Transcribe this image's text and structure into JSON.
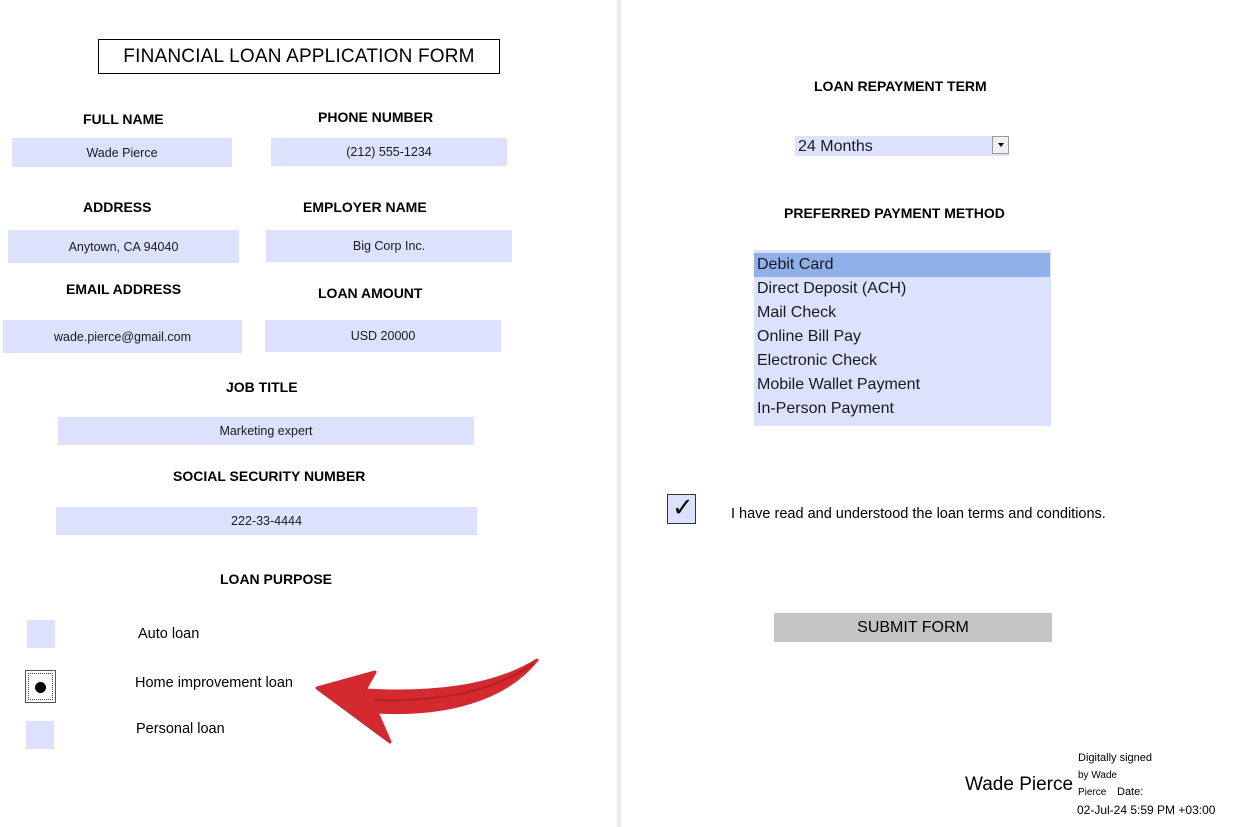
{
  "form": {
    "title": "FINANCIAL LOAN APPLICATION FORM"
  },
  "fields": {
    "full_name": {
      "label": "FULL NAME",
      "value": "Wade Pierce"
    },
    "phone_number": {
      "label": "PHONE NUMBER",
      "value": "(212) 555-1234"
    },
    "address": {
      "label": "ADDRESS",
      "value": "Anytown, CA 94040"
    },
    "employer_name": {
      "label": "EMPLOYER NAME",
      "value": "Big Corp Inc."
    },
    "email_address": {
      "label": "EMAIL ADDRESS",
      "value": "wade.pierce@gmail.com"
    },
    "loan_amount": {
      "label": "LOAN AMOUNT",
      "value": "USD 20000"
    },
    "job_title": {
      "label": "JOB TITLE",
      "value": "Marketing expert"
    },
    "ssn": {
      "label": "SOCIAL SECURITY NUMBER",
      "value": "222-33-4444"
    }
  },
  "loan_purpose": {
    "label": "LOAN PURPOSE",
    "options": [
      "Auto loan",
      "Home improvement loan",
      "Personal loan"
    ],
    "selected": "Home improvement loan"
  },
  "repayment_term": {
    "label": "LOAN REPAYMENT TERM",
    "value": "24 Months"
  },
  "payment_method": {
    "label": "PREFERRED PAYMENT METHOD",
    "options": [
      "Debit Card",
      "Direct Deposit (ACH)",
      "Mail Check",
      "Online Bill Pay",
      "Electronic Check",
      "Mobile Wallet Payment",
      "In-Person Payment"
    ],
    "selected": "Debit Card"
  },
  "terms": {
    "checked": true,
    "label": "I have read and understood the loan terms and conditions."
  },
  "submit": {
    "label": "SUBMIT FORM"
  },
  "signature": {
    "name": "Wade Pierce",
    "line1": "Digitally signed",
    "line2": "by Wade",
    "line3a": "Pierce",
    "line3b": "Date:",
    "date": "02-Jul-24 5:59 PM +03:00"
  },
  "colors": {
    "field_bg": "#dce1fd",
    "list_selected_bg": "#8fb0e8",
    "arrow": "#d3292f"
  }
}
